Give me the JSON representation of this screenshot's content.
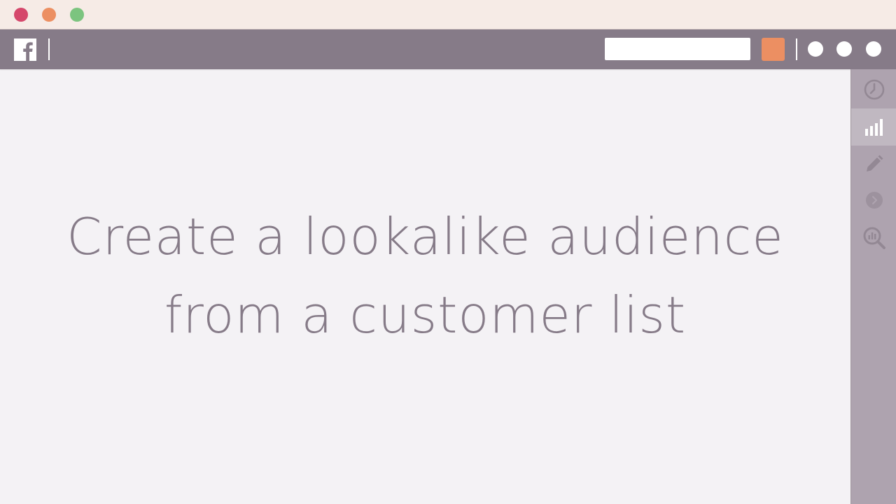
{
  "window_controls": {
    "close_color": "#d5476b",
    "minimize_color": "#ec8f62",
    "maximize_color": "#7cc47f"
  },
  "navbar": {
    "logo": "facebook-logo-icon",
    "search": {
      "value": "",
      "placeholder": ""
    },
    "accent_color": "#ec8f62",
    "menu_dots": [
      "dot-1",
      "dot-2",
      "dot-3"
    ]
  },
  "sidebar": {
    "items": [
      {
        "icon": "clock-icon",
        "active": false
      },
      {
        "icon": "bar-chart-icon",
        "active": true
      },
      {
        "icon": "pencil-icon",
        "active": false
      },
      {
        "icon": "chevron-right-icon",
        "active": false
      },
      {
        "icon": "magnifier-chart-icon",
        "active": false
      }
    ]
  },
  "main": {
    "headline_line1": "Create a lookalike audience",
    "headline_line2": "from a customer list"
  },
  "colors": {
    "navbar_bg": "#867b88",
    "sidebar_bg": "#aea3af",
    "content_bg": "#f4f2f5",
    "headline_text": "#867b88"
  }
}
